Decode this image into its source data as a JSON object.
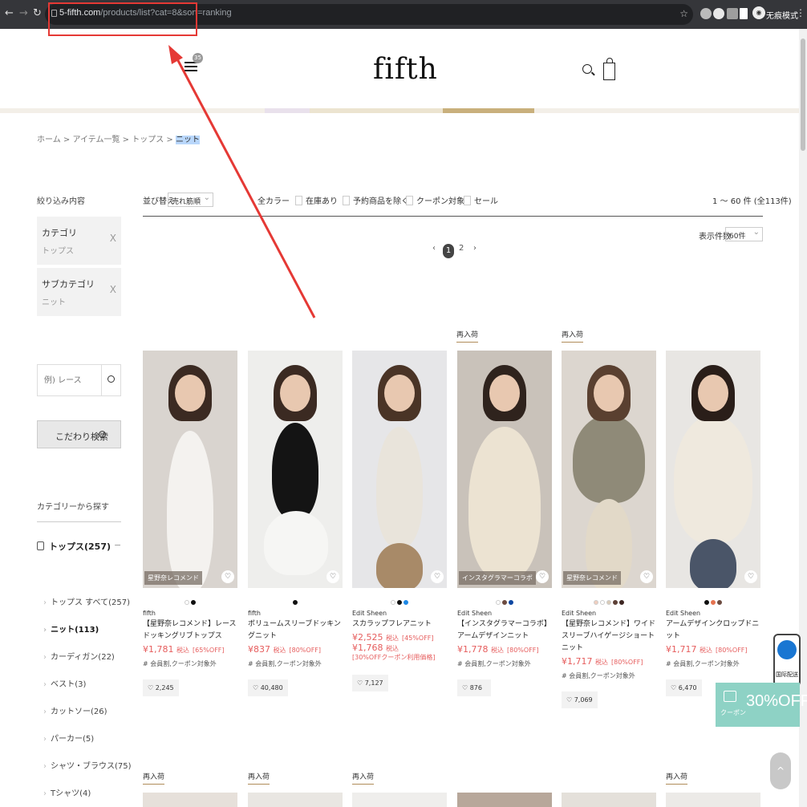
{
  "browser": {
    "url_domain": "5-fifth.com",
    "url_path": "/products/list?cat=8&sort=ranking",
    "incognito_label": "无痕模式"
  },
  "header": {
    "logo": "fifth",
    "menu_badge": "35"
  },
  "breadcrumb": [
    "ホーム",
    "アイテム一覧",
    "トップス",
    "ニット"
  ],
  "sidebar": {
    "filter_heading": "絞り込み内容",
    "filters": [
      {
        "title": "カテゴリ",
        "value": "トップス",
        "remove": "X"
      },
      {
        "title": "サブカテゴリ",
        "value": "ニット",
        "remove": "X"
      }
    ],
    "search_placeholder": "例) レース",
    "kodawari_label": "こだわり検索",
    "category_heading": "カテゴリーから探す",
    "tops_label": "トップス(257)",
    "tops_toggle": "−",
    "subcategories": [
      {
        "label": "トップス すべて(257)"
      },
      {
        "label": "ニット(113)"
      },
      {
        "label": "カーディガン(22)"
      },
      {
        "label": "ベスト(3)"
      },
      {
        "label": "カットソー(26)"
      },
      {
        "label": "パーカー(5)"
      },
      {
        "label": "シャツ・ブラウス(75)"
      },
      {
        "label": "Tシャツ(4)"
      }
    ]
  },
  "toolbar": {
    "sort_label": "並び替え",
    "sort_value": "売れ筋順",
    "color_label": "全カラー",
    "checkboxes": [
      "在庫あり",
      "予約商品を除く",
      "クーポン対象",
      "セール"
    ],
    "result_count": "1 ～ 60 件 (全113件)",
    "per_page_label": "表示件数",
    "per_page_value": "60件"
  },
  "pagination": {
    "prev": "‹",
    "pages": [
      "1",
      "2"
    ],
    "next": "›"
  },
  "restock_label": "再入荷",
  "products": [
    {
      "brand": "fifth",
      "name": "【星野奈レコメンド】レースドッキングリブトップス",
      "price": "¥1,781",
      "tax": "税込",
      "off": "[65%OFF]",
      "member": "# 会員割,クーポン対象外",
      "likes": "♡ 2,245",
      "tag": "星野奈レコメンド",
      "restock": false,
      "colors": [
        "#ffffff",
        "#111111"
      ]
    },
    {
      "brand": "fifth",
      "name": "ボリュームスリーブドッキングニット",
      "price": "¥837",
      "tax": "税込",
      "off": "[80%OFF]",
      "member": "# 会員割,クーポン対象外",
      "likes": "♡ 40,480",
      "tag": "",
      "restock": false,
      "colors": [
        "#111111"
      ]
    },
    {
      "brand": "Edit Sheen",
      "name": "スカラップフレアニット",
      "price": "¥2,525",
      "tax": "税込",
      "off": "[45%OFF]",
      "coupon_price": "¥1,768",
      "coupon_tax": "税込",
      "coupon_note": "[30%OFFクーポン利用価格]",
      "member": "",
      "likes": "♡ 7,127",
      "tag": "",
      "restock": false,
      "colors": [
        "#ffffff",
        "#111111",
        "#1e88e5"
      ]
    },
    {
      "brand": "Edit Sheen",
      "name": "【インスタグラマーコラボ】アームデザインニット",
      "price": "¥1,778",
      "tax": "税込",
      "off": "[80%OFF]",
      "member": "# 会員割,クーポン対象外",
      "likes": "♡ 876",
      "tag": "インスタグラマーコラボ",
      "restock": true,
      "colors": [
        "#ffffff",
        "#6d4c41",
        "#0d47a1"
      ]
    },
    {
      "brand": "Edit Sheen",
      "name": "【星野奈レコメンド】ワイドスリーブハイゲージショートニット",
      "price": "¥1,717",
      "tax": "税込",
      "off": "[80%OFF]",
      "member": "# 会員割,クーポン対象外",
      "likes": "♡ 7,069",
      "tag": "星野奈レコメンド",
      "restock": true,
      "colors": [
        "#f0cfc0",
        "#ffffff",
        "#d9cbb8",
        "#5d4037",
        "#3e2723"
      ]
    },
    {
      "brand": "Edit Sheen",
      "name": "アームデザインクロップドニット",
      "price": "¥1,717",
      "tax": "税込",
      "off": "[80%OFF]",
      "member": "# 会員割,クーポン対象外",
      "likes": "♡ 6,470",
      "tag": "",
      "restock": false,
      "colors": [
        "#111111",
        "#e57350",
        "#6d4c41"
      ]
    }
  ],
  "floating": {
    "global_label": "国际配送",
    "coupon_label": "クーポン",
    "coupon_pct": "30%OFF",
    "to_top": "^"
  },
  "annotation": {
    "box_color": "#e53935",
    "arrow_color": "#e53935"
  }
}
